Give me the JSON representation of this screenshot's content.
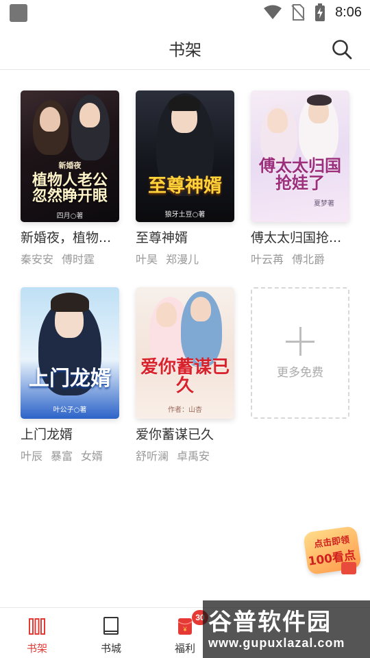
{
  "status_bar": {
    "time": "8:06",
    "icons": [
      "app-notification-icon",
      "wifi-icon",
      "no-sim-icon",
      "battery-charging-icon"
    ]
  },
  "header": {
    "title": "书架",
    "search_icon": "search-icon"
  },
  "books": [
    {
      "title": "新婚夜，植物...",
      "tags": [
        "秦安安",
        "傅时霆"
      ],
      "cover_text_small": "新婚夜",
      "cover_text_main": "植物人老公忽然睁开眼",
      "cover_author": "四月○著"
    },
    {
      "title": "至尊神婿",
      "tags": [
        "叶昊",
        "郑漫儿"
      ],
      "cover_text_main": "至尊神婿",
      "cover_author": "狼牙土豆○著"
    },
    {
      "title": "傅太太归国抢...",
      "tags": [
        "叶云苒",
        "傅北爵"
      ],
      "cover_text_main": "傅太太归国抢娃了",
      "cover_author": "夏梦著"
    },
    {
      "title": "上门龙婿",
      "tags": [
        "叶辰",
        "暴富",
        "女婿"
      ],
      "cover_text_main": "上门龙婿",
      "cover_author": "叶公子○著"
    },
    {
      "title": "爱你蓄谋已久",
      "tags": [
        "舒听澜",
        "卓禹安"
      ],
      "cover_text_main": "爱你蓄谋已久",
      "cover_author": "作者：山杏"
    }
  ],
  "add_more": {
    "label": "更多免费"
  },
  "promo": {
    "line1": "点击即领",
    "line2": "100看点"
  },
  "bottom_nav": {
    "items": [
      {
        "label": "书架",
        "icon": "bookshelf-icon",
        "active": true
      },
      {
        "label": "书城",
        "icon": "book-icon",
        "active": false
      },
      {
        "label": "福利",
        "icon": "red-envelope-icon",
        "active": false,
        "badge": "30"
      }
    ]
  },
  "watermark": {
    "line1": "谷普软件园",
    "line2": "www.gupuxlazal.com"
  },
  "colors": {
    "accent": "#e53935",
    "text_primary": "#333333",
    "text_secondary": "#999999",
    "divider": "#e6e6e6"
  }
}
